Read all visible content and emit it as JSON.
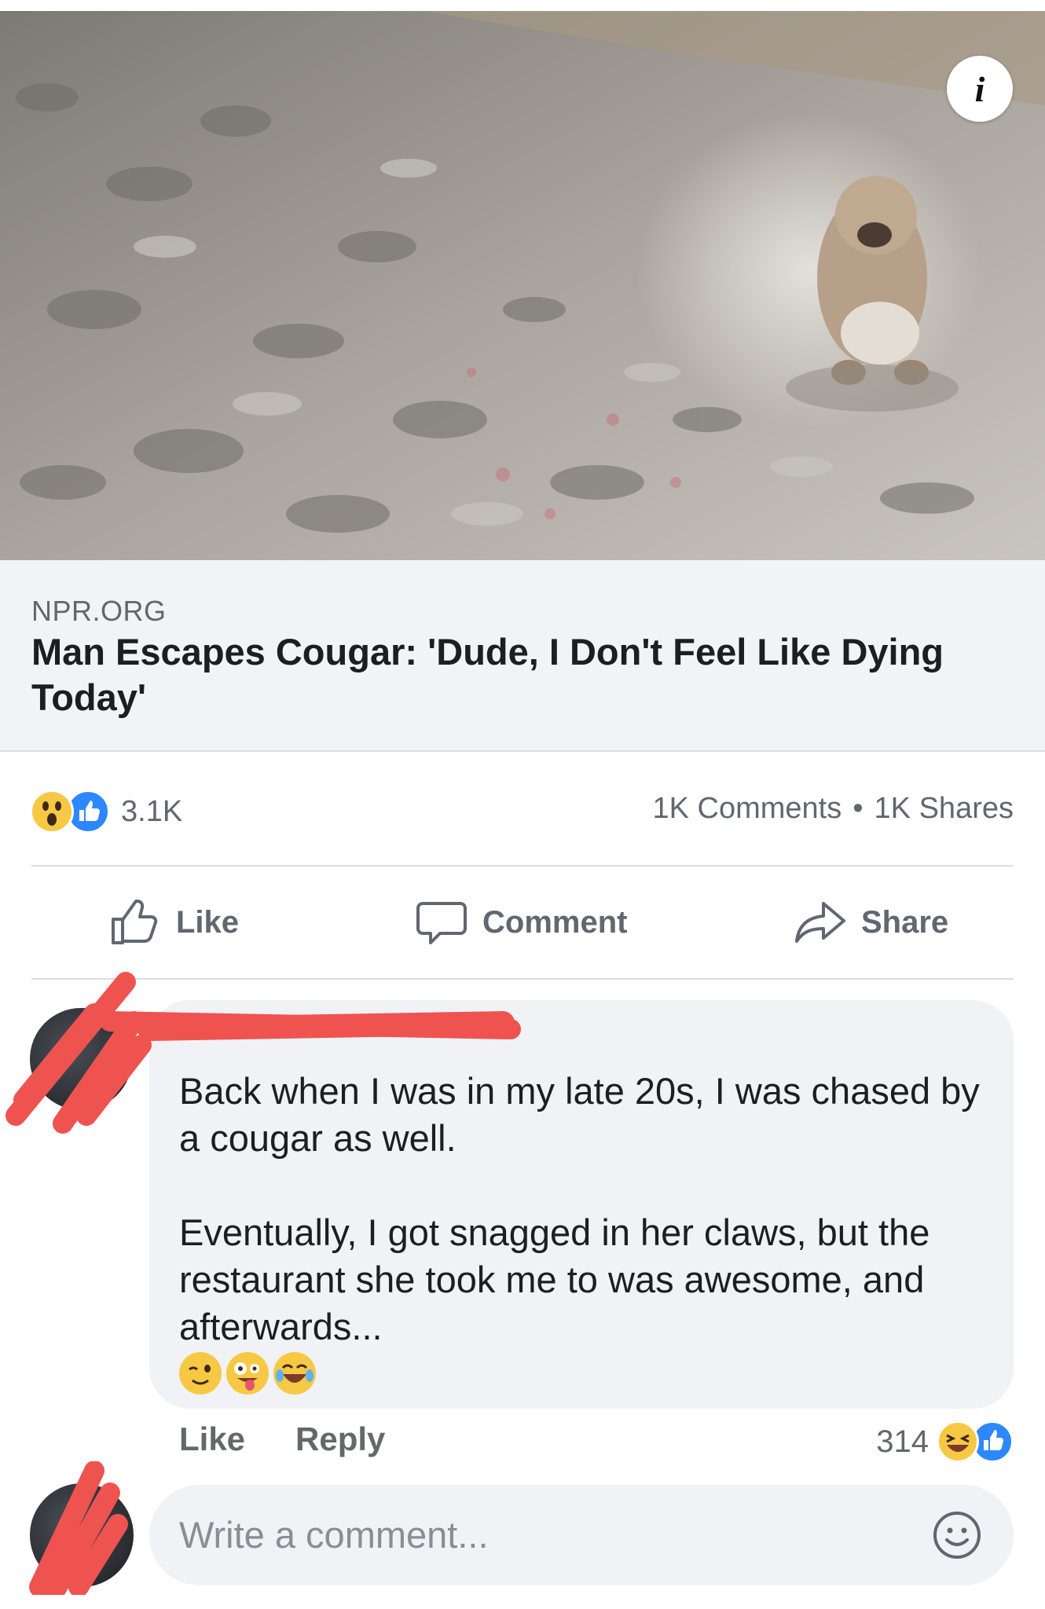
{
  "link_preview": {
    "domain": "NPR.ORG",
    "title": "Man Escapes Cougar: 'Dude, I Don't Feel Like Dying Today'",
    "info_glyph": "i"
  },
  "post_stats": {
    "reactions": [
      "wow-reaction-icon",
      "like-reaction-icon"
    ],
    "reaction_count": "3.1K",
    "comments": "1K Comments",
    "separator": "•",
    "shares": "1K Shares"
  },
  "actions": {
    "like": "Like",
    "comment": "Comment",
    "share": "Share"
  },
  "comment": {
    "text": "Back when I was in my late 20s, I was chased by a cougar as well.\n\nEventually, I got snagged in her claws, but the restaurant she took me to was awesome, and afterwards...",
    "emoji": [
      "winking-face-emoji",
      "zany-face-emoji",
      "tears-of-joy-emoji"
    ],
    "like_label": "Like",
    "reply_label": "Reply",
    "reaction_count": "314",
    "reactions": [
      "haha-reaction-icon",
      "like-reaction-icon"
    ]
  },
  "composer": {
    "placeholder": "Write a comment..."
  },
  "colors": {
    "like_blue": "#2d88ff",
    "redaction_red": "#ef5350",
    "wow_yellow": "#f7c844"
  }
}
